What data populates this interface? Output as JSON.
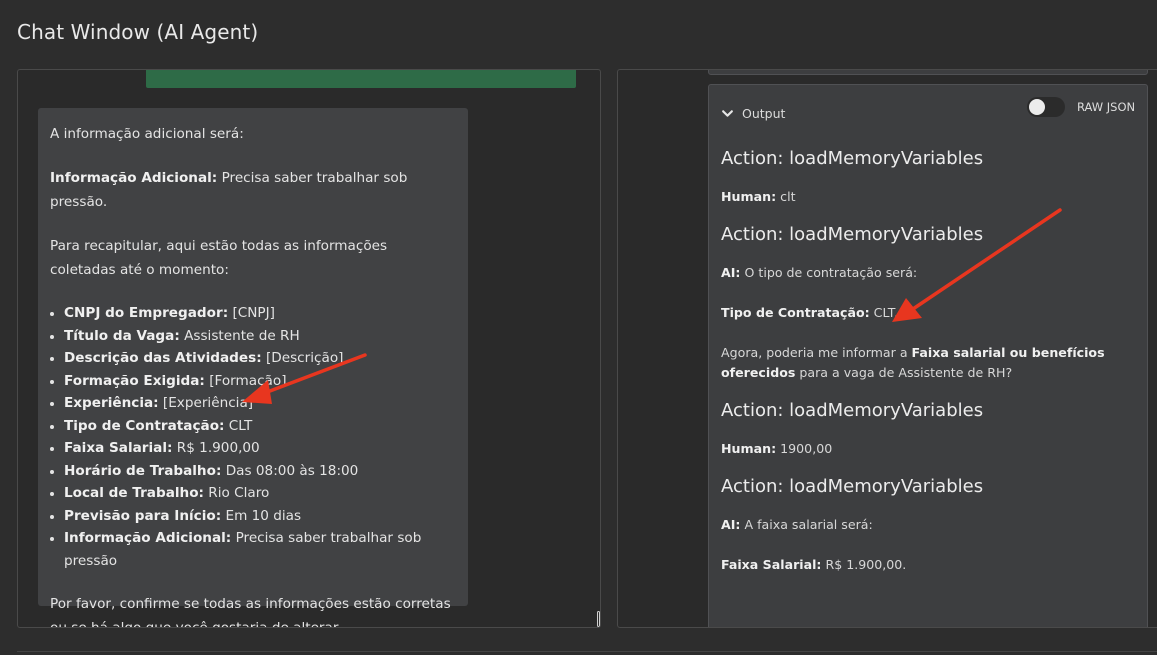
{
  "window": {
    "title": "Chat Window (AI Agent)"
  },
  "chat": {
    "ai_message": {
      "intro": "A informação adicional será:",
      "info_label": "Informação Adicional:",
      "info_value": " Precisa saber trabalhar sob pressão.",
      "recap": "Para recapitular, aqui estão todas as informações coletadas até o momento:",
      "items": [
        {
          "label": "CNPJ do Empregador:",
          "value": " [CNPJ]"
        },
        {
          "label": "Título da Vaga:",
          "value": " Assistente de RH"
        },
        {
          "label": "Descrição das Atividades:",
          "value": " [Descrição]"
        },
        {
          "label": "Formação Exigida:",
          "value": " [Formação]"
        },
        {
          "label": "Experiência:",
          "value": " [Experiência]"
        },
        {
          "label": "Tipo de Contratação:",
          "value": " CLT"
        },
        {
          "label": "Faixa Salarial:",
          "value": " R$ 1.900,00"
        },
        {
          "label": "Horário de Trabalho:",
          "value": " Das 08:00 às 18:00"
        },
        {
          "label": "Local de Trabalho:",
          "value": " Rio Claro"
        },
        {
          "label": "Previsão para Início:",
          "value": " Em 10 dias"
        },
        {
          "label": "Informação Adicional:",
          "value": " Precisa saber trabalhar sob pressão"
        }
      ],
      "closing": "Por favor, confirme se todas as informações estão corretas ou se há algo que você gostaria de alterar."
    }
  },
  "log": {
    "output_label": "Output",
    "raw_json_label": "RAW JSON",
    "raw_json_enabled": false,
    "entries": [
      {
        "title": "Action: loadMemoryVariables",
        "speaker": "Human:",
        "text": " clt"
      },
      {
        "title": "Action: loadMemoryVariables",
        "speaker": "AI:",
        "text": " O tipo de contratação será:",
        "sub_label": "Tipo de Contratação:",
        "sub_value": " CLT.",
        "question_pre": "Agora, poderia me informar a ",
        "question_bold": "Faixa salarial ou benefícios oferecidos",
        "question_post": " para a vaga de Assistente de RH?"
      },
      {
        "title": "Action: loadMemoryVariables",
        "speaker": "Human:",
        "text": " 1900,00"
      },
      {
        "title": "Action: loadMemoryVariables",
        "speaker": "AI:",
        "text": " A faixa salarial será:",
        "sub_label": "Faixa Salarial:",
        "sub_value": " R$ 1.900,00."
      }
    ]
  },
  "colors": {
    "annotation_arrow": "#e8361f",
    "user_bubble": "#2e6b47"
  },
  "icons": {
    "output_toggle": "chevron-down-icon"
  }
}
